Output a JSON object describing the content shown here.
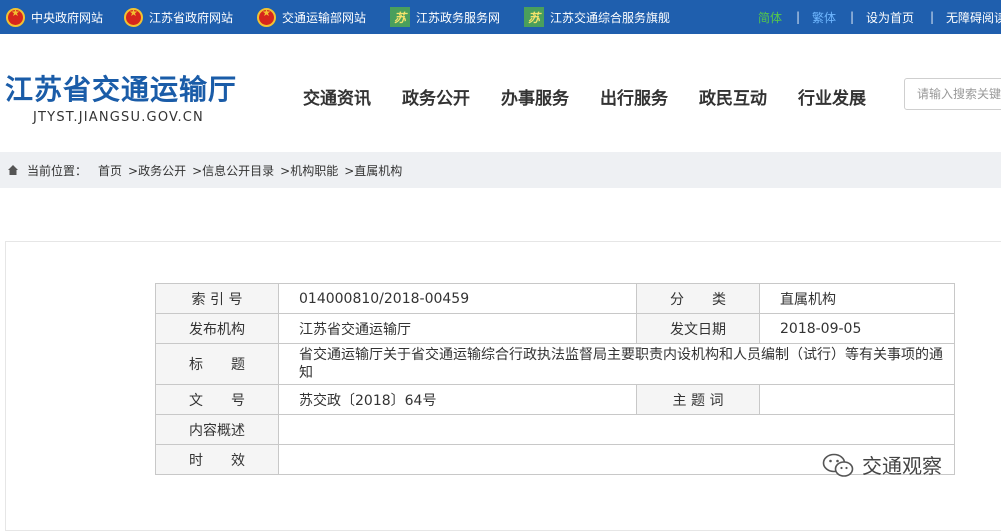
{
  "topbar": {
    "links": [
      {
        "label": "中央政府网站",
        "icon": "national-emblem-icon"
      },
      {
        "label": "江苏省政府网站",
        "icon": "national-emblem-icon"
      },
      {
        "label": "交通运输部网站",
        "icon": "national-emblem-icon"
      },
      {
        "label": "江苏政务服务网",
        "icon": "su-logo-icon"
      },
      {
        "label": "江苏交通综合服务旗舰",
        "icon": "su-logo-icon"
      }
    ],
    "right": {
      "simplified": "简体",
      "traditional": "繁体",
      "set_home": "设为首页",
      "accessibility": "无障碍阅读"
    },
    "colors": {
      "bg": "#1f5fae",
      "simplified": "#55c84a",
      "traditional": "#6fb7ff"
    }
  },
  "header": {
    "title": "江苏省交通运输厅",
    "domain": "JTYST.JIANGSU.GOV.CN",
    "nav": [
      "交通资讯",
      "政务公开",
      "办事服务",
      "出行服务",
      "政民互动",
      "行业发展"
    ],
    "search_placeholder": "请输入搜索关键字"
  },
  "breadcrumb": {
    "label": "当前位置：",
    "items": [
      "首页",
      ">政务公开",
      ">信息公开目录",
      ">机构职能",
      ">直属机构"
    ]
  },
  "info": {
    "index_label": "索 引 号",
    "index_value": "014000810/2018-00459",
    "category_label": "分　　类",
    "category_value": "直属机构",
    "publisher_label": "发布机构",
    "publisher_value": "江苏省交通运输厅",
    "date_label": "发文日期",
    "date_value": "2018-09-05",
    "title_label": "标　　题",
    "title_value": "省交通运输厅关于省交通运输综合行政执法监督局主要职责内设机构和人员编制（试行）等有关事项的通知",
    "docno_label": "文　　号",
    "docno_value": "苏交政〔2018〕64号",
    "subject_label": "主 题 词",
    "subject_value": "",
    "summary_label": "内容概述",
    "summary_value": "",
    "validity_label": "时　　效",
    "validity_value": ""
  },
  "watermark": {
    "text": "交通观察",
    "icon": "wechat-icon"
  }
}
